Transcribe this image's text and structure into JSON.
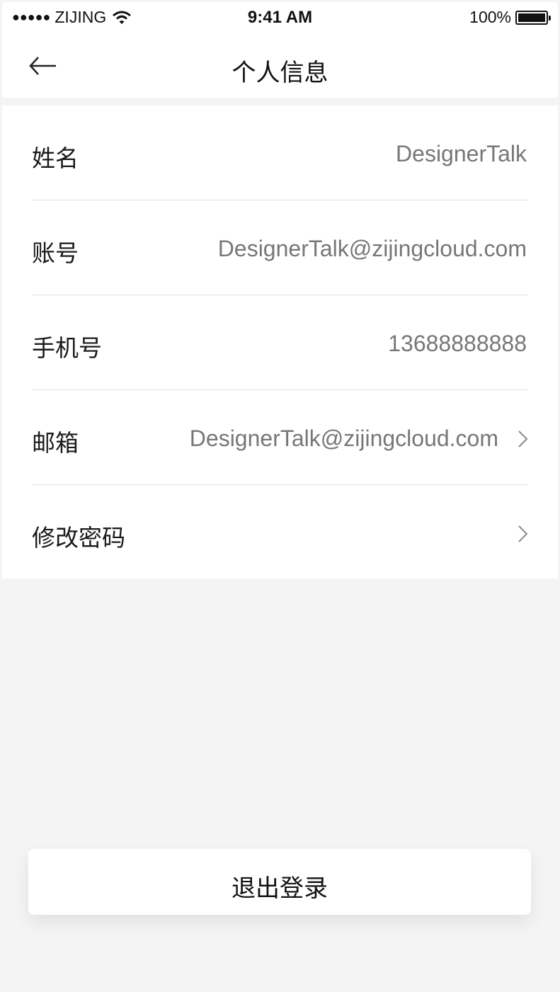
{
  "status_bar": {
    "signal": "●●●●●",
    "carrier": "ZIJING",
    "time": "9:41 AM",
    "battery": "100%"
  },
  "nav": {
    "title": "个人信息"
  },
  "rows": [
    {
      "label": "姓名",
      "value": "DesignerTalk"
    },
    {
      "label": "账号",
      "value": "DesignerTalk@zijingcloud.com"
    },
    {
      "label": "手机号",
      "value": "13688888888"
    },
    {
      "label": "邮箱",
      "value": "DesignerTalk@zijingcloud.com"
    },
    {
      "label": "修改密码",
      "value": ""
    }
  ],
  "logout": {
    "label": "退出登录"
  },
  "colors": {
    "background": "#f4f4f4",
    "card": "#ffffff",
    "value_text": "#777777",
    "divider": "#dedede"
  },
  "icons": [
    "wifi-icon",
    "battery-icon",
    "back-arrow-icon",
    "chevron-right-icon"
  ]
}
